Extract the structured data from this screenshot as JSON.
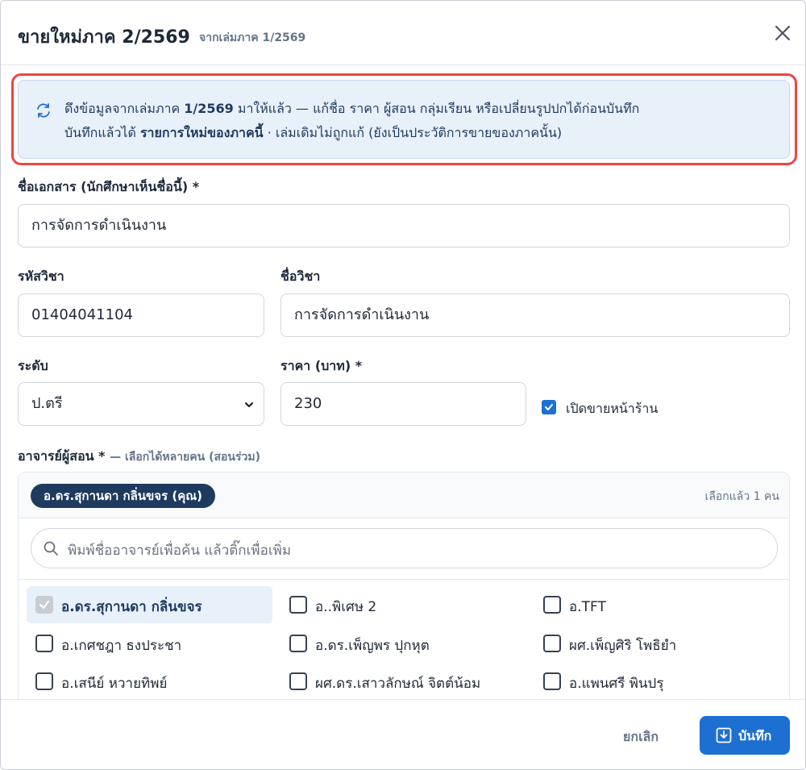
{
  "header": {
    "title": "ขายใหม่ภาค 2/2569",
    "subtitle": "จากเล่มภาค 1/2569"
  },
  "notice": {
    "line1_pre": "ดึงข้อมูลจากเล่มภาค ",
    "line1_bold": "1/2569",
    "line1_post": " มาให้แล้ว — แก้ชื่อ ราคา ผู้สอน กลุ่มเรียน หรือเปลี่ยนรูปปกได้ก่อนบันทึก",
    "line2_pre": "บันทึกแล้วได้ ",
    "line2_bold": "รายการใหม่ของภาคนี้",
    "line2_post": " · เล่มเดิมไม่ถูกแก้ (ยังเป็นประวัติการขายของภาคนั้น)"
  },
  "form": {
    "doc_name_label": "ชื่อเอกสาร (นักศึกษาเห็นชื่อนี้) *",
    "doc_name_value": "การจัดการดำเนินงาน",
    "course_code_label": "รหัสวิชา",
    "course_code_value": "01404041104",
    "course_name_label": "ชื่อวิชา",
    "course_name_value": "การจัดการดำเนินงาน",
    "level_label": "ระดับ",
    "level_value": "ป.ตรี",
    "price_label": "ราคา (บาท) *",
    "price_value": "230",
    "storefront_label": "เปิดขายหน้าร้าน",
    "storefront_checked": true
  },
  "instructors": {
    "label": "อาจารย์ผู้สอน *",
    "hint": "— เลือกได้หลายคน (สอนร่วม)",
    "selected_pill": "อ.ดร.สุกานดา กลิ่นขจร (คุณ)",
    "selected_count": "เลือกแล้ว 1 คน",
    "search_placeholder": "พิมพ์ชื่ออาจารย์เพื่อค้น แล้วติ๊กเพื่อเพิ่ม",
    "options": [
      {
        "name": "อ.ดร.สุกานดา กลิ่นขจร",
        "checked": true
      },
      {
        "name": "อ..พิเศษ 2",
        "checked": false
      },
      {
        "name": "อ.TFT",
        "checked": false
      },
      {
        "name": "อ.เกศชฎา ธงประชา",
        "checked": false
      },
      {
        "name": "อ.ดร.เพ็ญพร ปุกหุต",
        "checked": false
      },
      {
        "name": "ผศ.เพ็ญศิริ โพธิยำ",
        "checked": false
      },
      {
        "name": "อ.เสนีย์ หวายทิพย์",
        "checked": false
      },
      {
        "name": "ผศ.ดร.เสาวลักษณ์ จิตต์น้อม",
        "checked": false
      },
      {
        "name": "อ.แพนศรี พินปรุ",
        "checked": false
      }
    ]
  },
  "footer": {
    "cancel_label": "ยกเลิก",
    "save_label": "บันทึก"
  },
  "colors": {
    "primary": "#1d6fd1",
    "navy": "#1e3a5f",
    "highlight_outline": "#ef4444",
    "notice_bg": "#e8f0fa"
  }
}
